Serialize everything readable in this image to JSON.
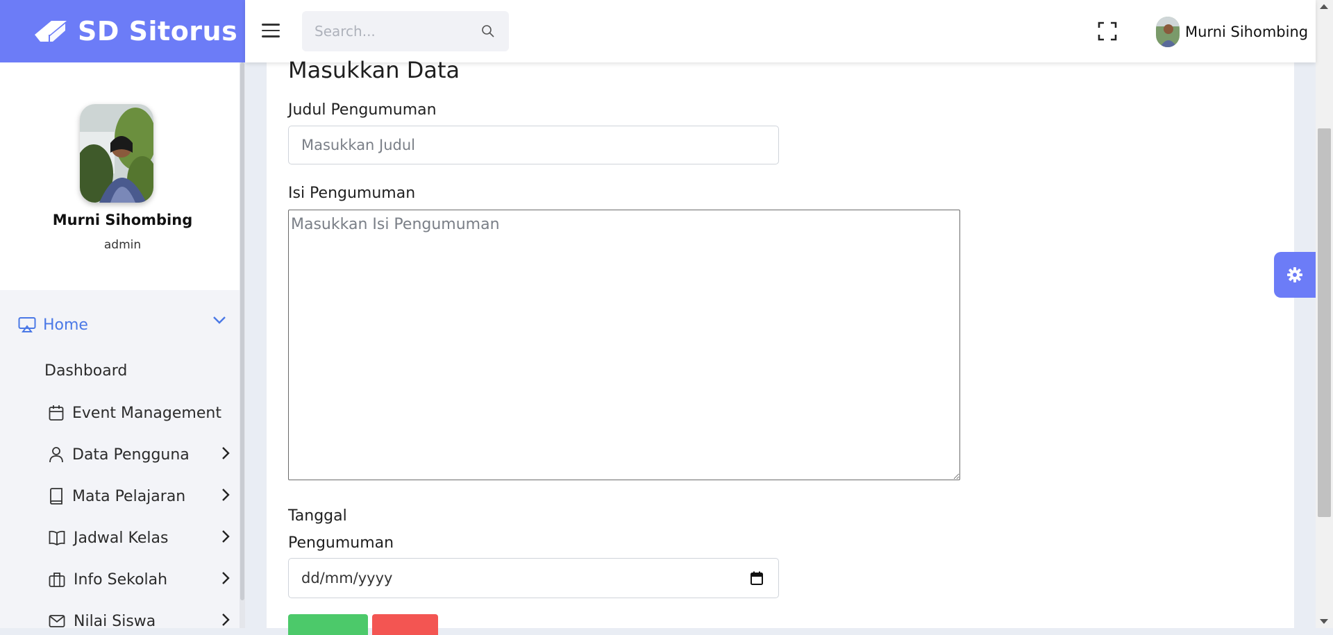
{
  "brand": {
    "name": "SD Sitorus",
    "logo_icon": "graduation-cap-icon",
    "color": "#6c7cf7"
  },
  "header": {
    "search_placeholder": "Search...",
    "user_name": "Murni Sihombing"
  },
  "profile": {
    "name": "Murni Sihombing",
    "role": "admin"
  },
  "sidebar": {
    "home_label": "Home",
    "home_color": "#4a78e6",
    "dashboard_label": "Dashboard",
    "items": [
      {
        "label": "Event Management",
        "icon": "calendar-icon",
        "has_arrow": false
      },
      {
        "label": "Data Pengguna",
        "icon": "user-icon",
        "has_arrow": true
      },
      {
        "label": "Mata Pelajaran",
        "icon": "book-icon",
        "has_arrow": true
      },
      {
        "label": "Jadwal Kelas",
        "icon": "open-book-icon",
        "has_arrow": true
      },
      {
        "label": "Info Sekolah",
        "icon": "briefcase-icon",
        "has_arrow": true
      },
      {
        "label": "Nilai Siswa",
        "icon": "mail-icon",
        "has_arrow": true
      }
    ]
  },
  "form": {
    "title": "Masukkan Data",
    "judul_label": "Judul Pengumuman",
    "judul_placeholder": "Masukkan Judul",
    "isi_label": "Isi Pengumuman",
    "isi_placeholder": "Masukkan Isi Pengumuman",
    "tanggal_label_line1": "Tanggal",
    "tanggal_label_line2": "Pengumuman",
    "tanggal_value": "dd/mm/yyyy",
    "submit_color": "#4cc96a",
    "cancel_color": "#f35552"
  }
}
